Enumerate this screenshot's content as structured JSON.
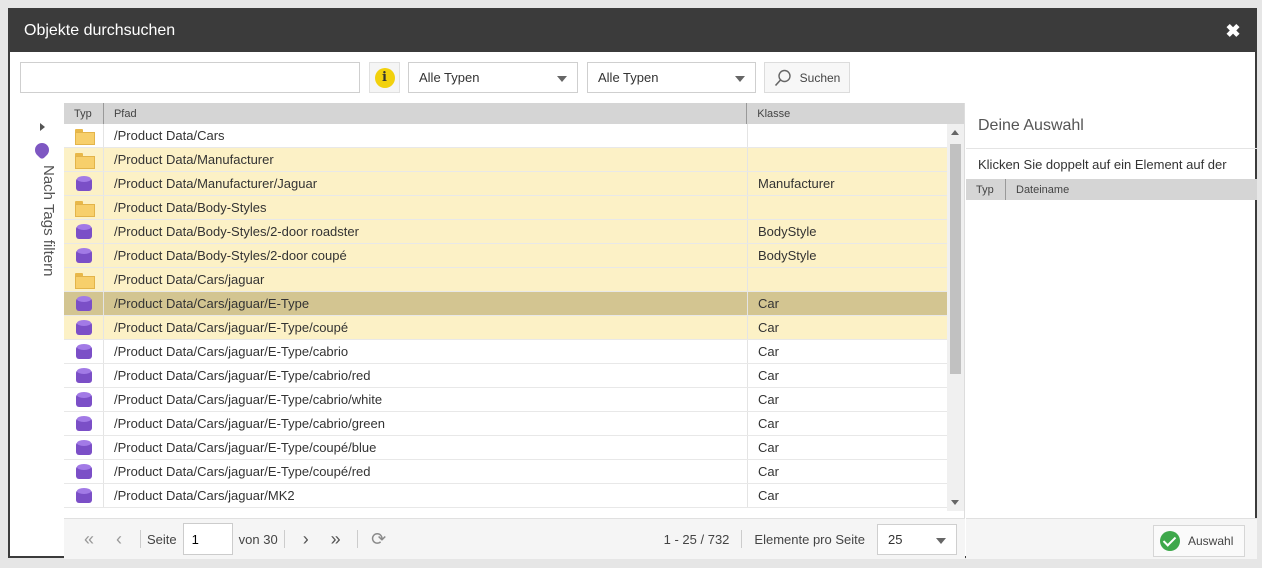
{
  "dialog": {
    "title": "Objekte durchsuchen",
    "close_glyph": "✖"
  },
  "toolbar": {
    "search_value": "",
    "info_glyph": "i",
    "type_filter_1": "Alle Typen",
    "type_filter_2": "Alle Typen",
    "search_label": "Suchen"
  },
  "side_tab": {
    "label": "Nach Tags filtern"
  },
  "grid": {
    "headers": {
      "typ": "Typ",
      "pfad": "Pfad",
      "klasse": "Klasse"
    },
    "rows": [
      {
        "icon": "folder-icon",
        "path": "/Product Data/Cars",
        "klasse": "",
        "state": "normal"
      },
      {
        "icon": "folder-icon",
        "path": "/Product Data/Manufacturer",
        "klasse": "",
        "state": "selected"
      },
      {
        "icon": "object-icon",
        "path": "/Product Data/Manufacturer/Jaguar",
        "klasse": "Manufacturer",
        "state": "selected"
      },
      {
        "icon": "folder-icon",
        "path": "/Product Data/Body-Styles",
        "klasse": "",
        "state": "selected"
      },
      {
        "icon": "object-icon",
        "path": "/Product Data/Body-Styles/2-door roadster",
        "klasse": "BodyStyle",
        "state": "selected"
      },
      {
        "icon": "object-icon",
        "path": "/Product Data/Body-Styles/2-door coupé",
        "klasse": "BodyStyle",
        "state": "selected"
      },
      {
        "icon": "folder-icon",
        "path": "/Product Data/Cars/jaguar",
        "klasse": "",
        "state": "selected"
      },
      {
        "icon": "object-icon",
        "path": "/Product Data/Cars/jaguar/E-Type",
        "klasse": "Car",
        "state": "current"
      },
      {
        "icon": "object-icon",
        "path": "/Product Data/Cars/jaguar/E-Type/coupé",
        "klasse": "Car",
        "state": "selected"
      },
      {
        "icon": "object-icon",
        "path": "/Product Data/Cars/jaguar/E-Type/cabrio",
        "klasse": "Car",
        "state": "normal"
      },
      {
        "icon": "object-icon",
        "path": "/Product Data/Cars/jaguar/E-Type/cabrio/red",
        "klasse": "Car",
        "state": "normal"
      },
      {
        "icon": "object-icon",
        "path": "/Product Data/Cars/jaguar/E-Type/cabrio/white",
        "klasse": "Car",
        "state": "normal"
      },
      {
        "icon": "object-icon",
        "path": "/Product Data/Cars/jaguar/E-Type/cabrio/green",
        "klasse": "Car",
        "state": "normal"
      },
      {
        "icon": "object-icon",
        "path": "/Product Data/Cars/jaguar/E-Type/coupé/blue",
        "klasse": "Car",
        "state": "normal"
      },
      {
        "icon": "object-icon",
        "path": "/Product Data/Cars/jaguar/E-Type/coupé/red",
        "klasse": "Car",
        "state": "normal"
      },
      {
        "icon": "object-icon",
        "path": "/Product Data/Cars/jaguar/MK2",
        "klasse": "Car",
        "state": "normal"
      }
    ]
  },
  "pager": {
    "first_glyph": "«",
    "prev_glyph": "‹",
    "page_label": "Seite",
    "page_value": "1",
    "of_label": "von 30",
    "next_glyph": "›",
    "last_glyph": "»",
    "refresh_glyph": "⟳",
    "range_text": "1 - 25 / 732",
    "per_page_label": "Elemente pro Seite",
    "per_page_value": "25"
  },
  "selection": {
    "title": "Deine Auswahl",
    "hint": "Klicken Sie doppelt auf ein Element auf der",
    "headers": {
      "typ": "Typ",
      "dateiname": "Dateiname"
    },
    "ok_label": "Auswahl"
  },
  "colors": {
    "titlebar": "#3b3b3b",
    "selected_row": "#fcf1c6",
    "current_row": "#d3c591",
    "object_icon": "#7b4fc7",
    "folder_icon": "#f7cf6b"
  }
}
